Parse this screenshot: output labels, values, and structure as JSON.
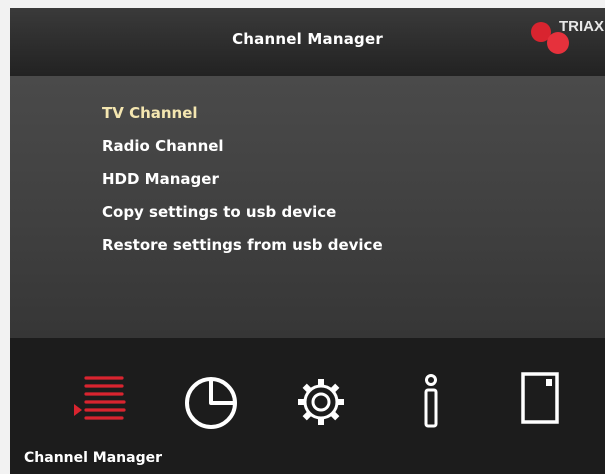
{
  "header": {
    "title": "Channel Manager",
    "brand": "TRIAX"
  },
  "menu": {
    "items": [
      {
        "label": "TV Channel",
        "selected": true
      },
      {
        "label": "Radio Channel",
        "selected": false
      },
      {
        "label": "HDD Manager",
        "selected": false
      },
      {
        "label": "Copy settings to usb device",
        "selected": false
      },
      {
        "label": "Restore settings from usb device",
        "selected": false
      }
    ]
  },
  "footer": {
    "active_label": "Channel Manager",
    "icons": [
      {
        "name": "channel-list-icon",
        "active": true
      },
      {
        "name": "timer-pie-icon",
        "active": false
      },
      {
        "name": "settings-gear-icon",
        "active": false
      },
      {
        "name": "info-icon",
        "active": false
      },
      {
        "name": "media-card-icon",
        "active": false
      }
    ]
  },
  "colors": {
    "accent": "#d9242f",
    "selected_text": "#f4e6b0",
    "text": "#ffffff",
    "background": "#2c2c2c"
  }
}
